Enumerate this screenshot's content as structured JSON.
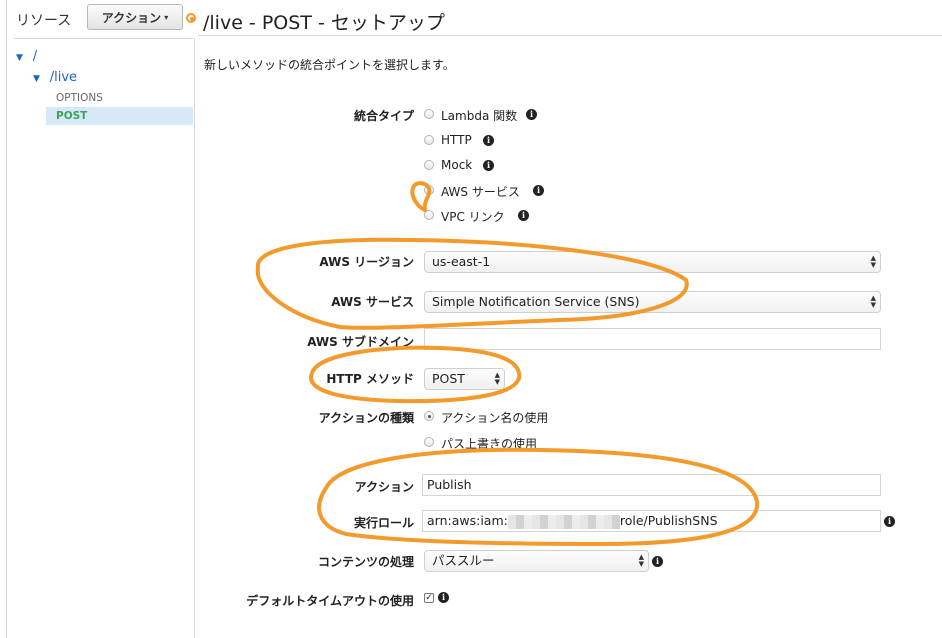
{
  "sidebar": {
    "resources_label": "リソース",
    "actions_button": "アクション",
    "tree": {
      "root": "/",
      "live": "/live",
      "options": "OPTIONS",
      "post": "POST"
    }
  },
  "header": {
    "title": "/live - POST - セットアップ",
    "description": "新しいメソッドの統合ポイントを選択します。"
  },
  "form": {
    "integration_type_label": "統合タイプ",
    "integration_types": [
      {
        "label": "Lambda 関数",
        "selected": false
      },
      {
        "label": "HTTP",
        "selected": false
      },
      {
        "label": "Mock",
        "selected": false
      },
      {
        "label": "AWS サービス",
        "selected": true
      },
      {
        "label": "VPC リンク",
        "selected": false
      }
    ],
    "aws_region_label": "AWS リージョン",
    "aws_region_value": "us-east-1",
    "aws_service_label": "AWS サービス",
    "aws_service_value": "Simple Notification Service (SNS)",
    "aws_subdomain_label": "AWS サブドメイン",
    "aws_subdomain_value": "",
    "http_method_label": "HTTP メソッド",
    "http_method_value": "POST",
    "action_type_label": "アクションの種類",
    "action_types": [
      {
        "label": "アクション名の使用",
        "selected": true
      },
      {
        "label": "パス上書きの使用",
        "selected": false
      }
    ],
    "action_label": "アクション",
    "action_value": "Publish",
    "execution_role_label": "実行ロール",
    "execution_role_prefix": "arn:aws:iam:",
    "execution_role_suffix": "role/PublishSNS",
    "content_handling_label": "コンテンツの処理",
    "content_handling_value": "パススルー",
    "default_timeout_label": "デフォルトタイムアウトの使用",
    "default_timeout_checked": true
  },
  "colors": {
    "annotation": "#f39a2c",
    "link": "#1a66c8",
    "selected_method": "#3ba458"
  }
}
